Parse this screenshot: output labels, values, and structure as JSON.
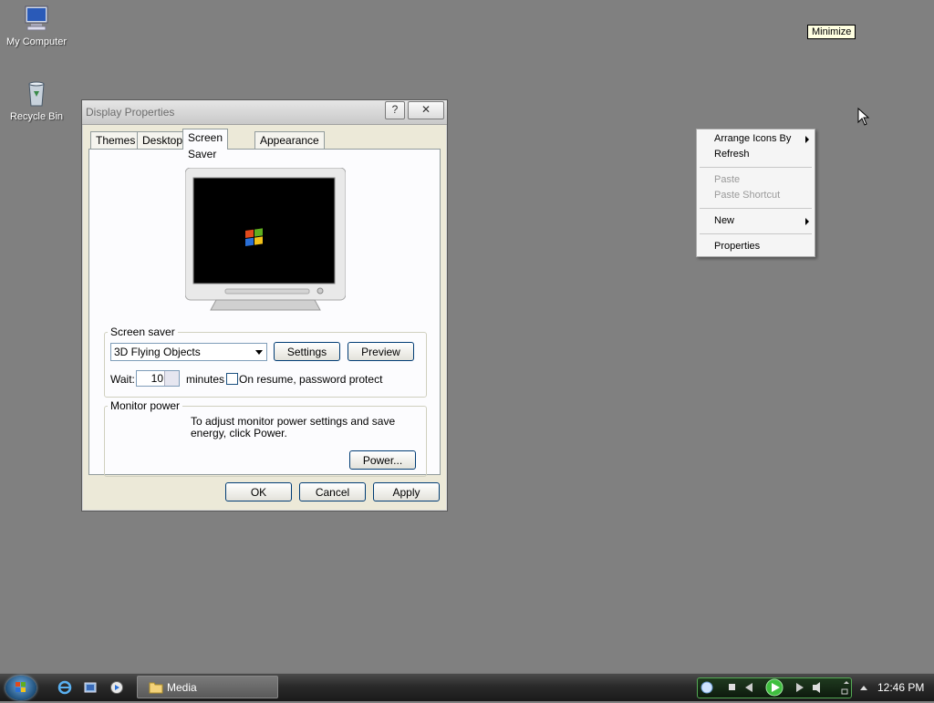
{
  "desktop": {
    "icons": [
      {
        "label": "My Computer"
      },
      {
        "label": "Recycle Bin"
      }
    ],
    "tooltip": "Minimize"
  },
  "context_menu": {
    "items": [
      {
        "label": "Arrange Icons By",
        "submenu": true,
        "enabled": true
      },
      {
        "label": "Refresh",
        "enabled": true
      },
      {
        "label": "Paste",
        "enabled": false
      },
      {
        "label": "Paste Shortcut",
        "enabled": false
      },
      {
        "label": "New",
        "submenu": true,
        "enabled": true
      },
      {
        "label": "Properties",
        "enabled": true
      }
    ]
  },
  "dialog": {
    "title": "Display Properties",
    "help_label": "?",
    "close_label": "✕",
    "tabs": [
      {
        "label": "Themes"
      },
      {
        "label": "Desktop"
      },
      {
        "label": "Screen Saver",
        "active": true
      },
      {
        "label": "Appearance"
      }
    ],
    "screen_saver": {
      "group_label": "Screen saver",
      "selected": "3D Flying Objects",
      "settings_label": "Settings",
      "preview_label": "Preview",
      "wait_label": "Wait:",
      "wait_value": "10",
      "minutes_label": "minutes",
      "password_label": "On resume, password protect",
      "password_checked": false
    },
    "monitor_power": {
      "group_label": "Monitor power",
      "description": "To adjust monitor power settings and save energy, click Power.",
      "power_label": "Power..."
    },
    "buttons": {
      "ok": "OK",
      "cancel": "Cancel",
      "apply": "Apply"
    }
  },
  "taskbar": {
    "task_label": "Media",
    "clock": "12:46 PM"
  },
  "colors": {
    "desktop": "#808080",
    "dialog_face": "#ece9d8",
    "taskbar": "#2a2a2a"
  }
}
